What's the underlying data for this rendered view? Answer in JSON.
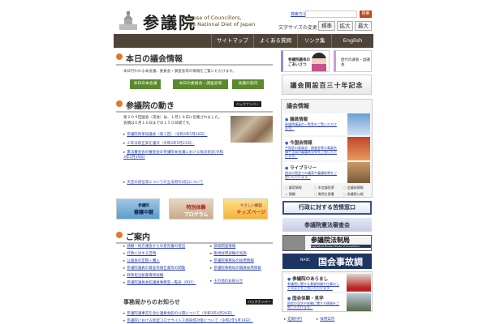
{
  "header": {
    "logo_jp": "参議院",
    "logo_en_1": "House of Councillors,",
    "logo_en_2": "The National Diet of Japan",
    "search_help": "検索方法",
    "search_placeholder": "",
    "search_button": "検索",
    "font_size_label": "文字サイズの変更",
    "font_sizes": [
      "標準",
      "拡大",
      "最大"
    ]
  },
  "nav": [
    "サイトマップ",
    "よくある質問",
    "リンク集",
    "English"
  ],
  "today": {
    "title": "本日の議会情報",
    "desc": "本日行われる本会議、委員会・調査会等の情報をご覧いただけます。",
    "buttons": [
      "本日の本会議",
      "本日の委員会・調査会等",
      "会議の案内"
    ]
  },
  "activity": {
    "title": "参議院の動き",
    "back_number": "バックナンバー",
    "intro_1": "第２０４回国会（常会）は、１月１８日に召集されました。",
    "intro_2": "会期は６月１６日までの１５０日間です。",
    "links": [
      "参議院改革協議会（第１回）（令和3年5月26日）",
      "少年法改正案を議決（令和3年5月21日）",
      "憲法審査会の審査会の参議院本会議における採決状況(令和3年5月19日)",
      "天皇の退位等についての立法府の対応について"
    ]
  },
  "banners": [
    {
      "line1": "参議院",
      "line2": "審議中継"
    },
    {
      "line1": "特別体験",
      "line2": "プログラム"
    },
    {
      "line1": "やさしい解説",
      "line2": "キッズページ"
    }
  ],
  "guide": {
    "title": "ご案内",
    "left": [
      "請願・地方議会からの意見書の提出",
      "行政に対する苦情",
      "公報係の定期・購入",
      "参議院議員の資産等報告書等の閲覧",
      "政策担当秘書資格試験",
      "参議院議員会館議員事務室一覧表（PDF）"
    ],
    "right": [
      "調達関連情報",
      "衛視採用試験の実施",
      "参議院事務局の採用情報",
      "参議院事務局の職員採用情報",
      "その他のお知らせ"
    ]
  },
  "notices": {
    "title": "事務局からのお知らせ",
    "back_number": "バックナンバー",
    "links": [
      "参議院議事堂を含む議員会館の公開について（令和3年4月26日）",
      "参議院における新型コロナウイルス感染症対策について（令和2年5月18日）"
    ]
  },
  "right": {
    "greeting": "参議院議長のごあいさつ",
    "history": "歴代の議長・副議長",
    "anniversary": "議会開設百三十年記念",
    "diet_info": {
      "title": "議会情報",
      "items": [
        {
          "title": "議員情報",
          "desc": "参議院議員の一覧等をご覧いただけます。"
        },
        {
          "title": "今国会情報",
          "desc": "今国会の委員会・調査会等の委員名簿や法案の審議状況等をご覧いただけます。"
        },
        {
          "title": "ライブラリー",
          "desc": "過去の国会での議案や審議結果をご覧いただけます。"
        }
      ],
      "mini": [
        "議案情報",
        "本会議投票",
        "会議録情報",
        "請願",
        "質問主意書",
        "参議院公報"
      ]
    },
    "complaint": "行政に対する苦情窓口",
    "kenpo": "参議院憲法審査会",
    "legis": "参議院法制局",
    "legis_en": "Legislative Bureau House of Councillors",
    "naiic_label": "NAIIC",
    "naiic": "国会事故調",
    "overview": [
      {
        "title": "参議院のあらまし",
        "desc": "参議院に関する基礎知識や仕事のしくみなどをご覧いただけます。"
      },
      {
        "title": "国会体験・見学",
        "desc": "国会の見学や体験に関する情報をご覧いただけます。"
      }
    ],
    "footer_links": [
      "定期刊行",
      "採用案内"
    ]
  }
}
